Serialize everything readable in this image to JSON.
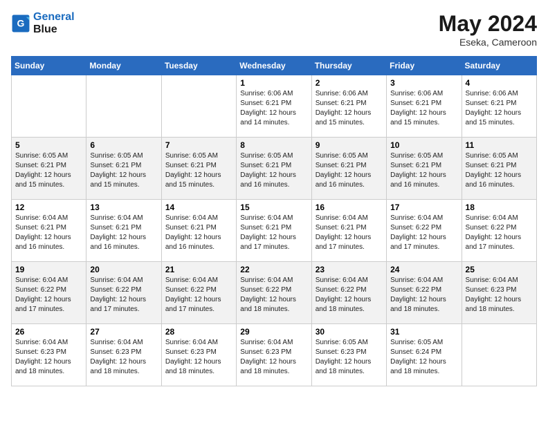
{
  "header": {
    "logo_line1": "General",
    "logo_line2": "Blue",
    "month": "May 2024",
    "location": "Eseka, Cameroon"
  },
  "columns": [
    "Sunday",
    "Monday",
    "Tuesday",
    "Wednesday",
    "Thursday",
    "Friday",
    "Saturday"
  ],
  "weeks": [
    [
      {
        "day": "",
        "info": ""
      },
      {
        "day": "",
        "info": ""
      },
      {
        "day": "",
        "info": ""
      },
      {
        "day": "1",
        "info": "Sunrise: 6:06 AM\nSunset: 6:21 PM\nDaylight: 12 hours\nand 14 minutes."
      },
      {
        "day": "2",
        "info": "Sunrise: 6:06 AM\nSunset: 6:21 PM\nDaylight: 12 hours\nand 15 minutes."
      },
      {
        "day": "3",
        "info": "Sunrise: 6:06 AM\nSunset: 6:21 PM\nDaylight: 12 hours\nand 15 minutes."
      },
      {
        "day": "4",
        "info": "Sunrise: 6:06 AM\nSunset: 6:21 PM\nDaylight: 12 hours\nand 15 minutes."
      }
    ],
    [
      {
        "day": "5",
        "info": "Sunrise: 6:05 AM\nSunset: 6:21 PM\nDaylight: 12 hours\nand 15 minutes."
      },
      {
        "day": "6",
        "info": "Sunrise: 6:05 AM\nSunset: 6:21 PM\nDaylight: 12 hours\nand 15 minutes."
      },
      {
        "day": "7",
        "info": "Sunrise: 6:05 AM\nSunset: 6:21 PM\nDaylight: 12 hours\nand 15 minutes."
      },
      {
        "day": "8",
        "info": "Sunrise: 6:05 AM\nSunset: 6:21 PM\nDaylight: 12 hours\nand 16 minutes."
      },
      {
        "day": "9",
        "info": "Sunrise: 6:05 AM\nSunset: 6:21 PM\nDaylight: 12 hours\nand 16 minutes."
      },
      {
        "day": "10",
        "info": "Sunrise: 6:05 AM\nSunset: 6:21 PM\nDaylight: 12 hours\nand 16 minutes."
      },
      {
        "day": "11",
        "info": "Sunrise: 6:05 AM\nSunset: 6:21 PM\nDaylight: 12 hours\nand 16 minutes."
      }
    ],
    [
      {
        "day": "12",
        "info": "Sunrise: 6:04 AM\nSunset: 6:21 PM\nDaylight: 12 hours\nand 16 minutes."
      },
      {
        "day": "13",
        "info": "Sunrise: 6:04 AM\nSunset: 6:21 PM\nDaylight: 12 hours\nand 16 minutes."
      },
      {
        "day": "14",
        "info": "Sunrise: 6:04 AM\nSunset: 6:21 PM\nDaylight: 12 hours\nand 16 minutes."
      },
      {
        "day": "15",
        "info": "Sunrise: 6:04 AM\nSunset: 6:21 PM\nDaylight: 12 hours\nand 17 minutes."
      },
      {
        "day": "16",
        "info": "Sunrise: 6:04 AM\nSunset: 6:21 PM\nDaylight: 12 hours\nand 17 minutes."
      },
      {
        "day": "17",
        "info": "Sunrise: 6:04 AM\nSunset: 6:22 PM\nDaylight: 12 hours\nand 17 minutes."
      },
      {
        "day": "18",
        "info": "Sunrise: 6:04 AM\nSunset: 6:22 PM\nDaylight: 12 hours\nand 17 minutes."
      }
    ],
    [
      {
        "day": "19",
        "info": "Sunrise: 6:04 AM\nSunset: 6:22 PM\nDaylight: 12 hours\nand 17 minutes."
      },
      {
        "day": "20",
        "info": "Sunrise: 6:04 AM\nSunset: 6:22 PM\nDaylight: 12 hours\nand 17 minutes."
      },
      {
        "day": "21",
        "info": "Sunrise: 6:04 AM\nSunset: 6:22 PM\nDaylight: 12 hours\nand 17 minutes."
      },
      {
        "day": "22",
        "info": "Sunrise: 6:04 AM\nSunset: 6:22 PM\nDaylight: 12 hours\nand 18 minutes."
      },
      {
        "day": "23",
        "info": "Sunrise: 6:04 AM\nSunset: 6:22 PM\nDaylight: 12 hours\nand 18 minutes."
      },
      {
        "day": "24",
        "info": "Sunrise: 6:04 AM\nSunset: 6:22 PM\nDaylight: 12 hours\nand 18 minutes."
      },
      {
        "day": "25",
        "info": "Sunrise: 6:04 AM\nSunset: 6:23 PM\nDaylight: 12 hours\nand 18 minutes."
      }
    ],
    [
      {
        "day": "26",
        "info": "Sunrise: 6:04 AM\nSunset: 6:23 PM\nDaylight: 12 hours\nand 18 minutes."
      },
      {
        "day": "27",
        "info": "Sunrise: 6:04 AM\nSunset: 6:23 PM\nDaylight: 12 hours\nand 18 minutes."
      },
      {
        "day": "28",
        "info": "Sunrise: 6:04 AM\nSunset: 6:23 PM\nDaylight: 12 hours\nand 18 minutes."
      },
      {
        "day": "29",
        "info": "Sunrise: 6:04 AM\nSunset: 6:23 PM\nDaylight: 12 hours\nand 18 minutes."
      },
      {
        "day": "30",
        "info": "Sunrise: 6:05 AM\nSunset: 6:23 PM\nDaylight: 12 hours\nand 18 minutes."
      },
      {
        "day": "31",
        "info": "Sunrise: 6:05 AM\nSunset: 6:24 PM\nDaylight: 12 hours\nand 18 minutes."
      },
      {
        "day": "",
        "info": ""
      }
    ]
  ]
}
